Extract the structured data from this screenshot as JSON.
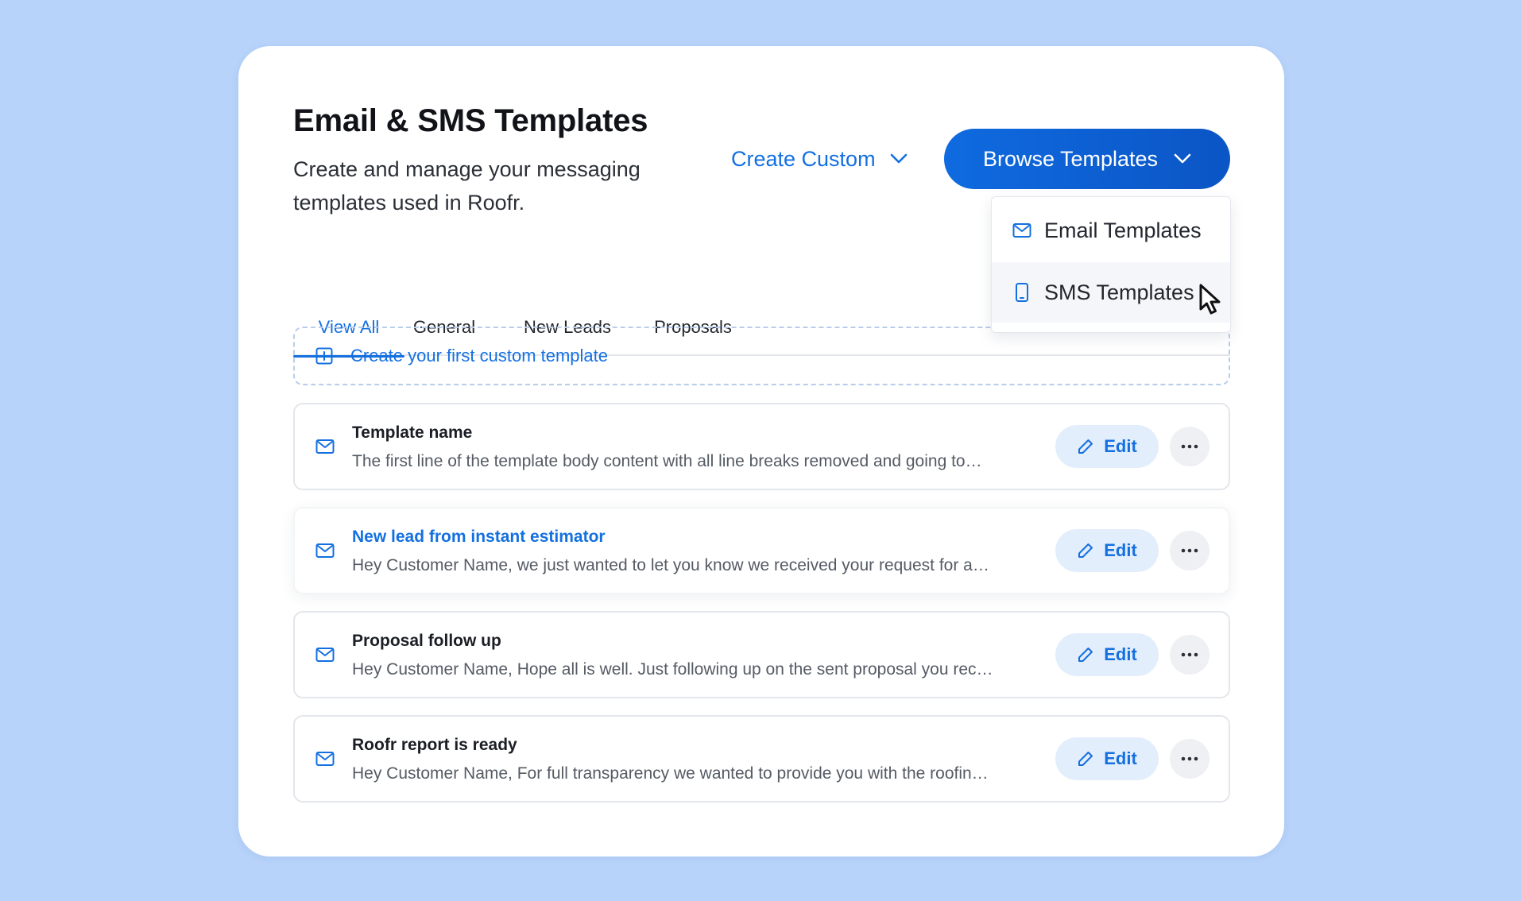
{
  "header": {
    "title": "Email & SMS Templates",
    "description": "Create and manage your messaging templates used in Roofr."
  },
  "actions": {
    "create_custom_label": "Create Custom",
    "browse_templates_label": "Browse Templates"
  },
  "dropdown": {
    "items": [
      {
        "label": "Email Templates",
        "icon": "mail-icon"
      },
      {
        "label": "SMS Templates",
        "icon": "phone-icon"
      }
    ]
  },
  "tabs": [
    {
      "label": "View All",
      "active": true
    },
    {
      "label": "General",
      "active": false
    },
    {
      "label": "New Leads",
      "active": false
    },
    {
      "label": "Proposals",
      "active": false
    }
  ],
  "create_first": {
    "label": "Create your first custom template"
  },
  "templates": [
    {
      "title": "Template name",
      "body": "The first line of the template body content with all line breaks removed and going to…",
      "edit_label": "Edit"
    },
    {
      "title": "New lead from instant estimator",
      "body": "Hey Customer Name, we just wanted to let you know we received your request for a…",
      "edit_label": "Edit"
    },
    {
      "title": "Proposal follow up",
      "body": "Hey Customer Name, Hope all is well. Just following up on the sent proposal you rec…",
      "edit_label": "Edit"
    },
    {
      "title": "Roofr report is ready",
      "body": "Hey Customer Name, For full transparency we wanted to provide you with the roofin…",
      "edit_label": "Edit"
    }
  ],
  "colors": {
    "background": "#b7d3fa",
    "accent": "#1470e0",
    "primary_button": "#0f6be0",
    "edit_button_bg": "#e3eefc"
  }
}
